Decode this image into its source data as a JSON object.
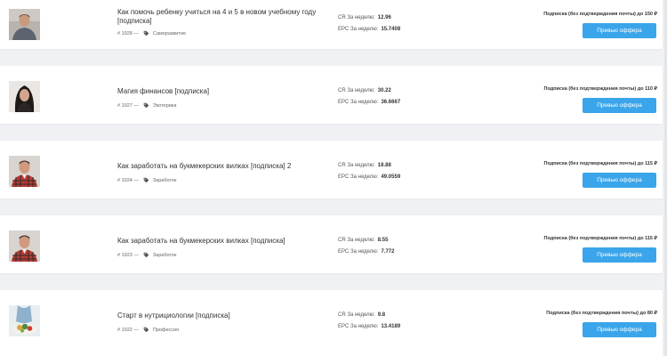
{
  "offers": [
    {
      "title": "Как помочь ребенку учиться на 4 и 5 в новом учебному году [подписка]",
      "id": "# 1928 —",
      "category": "Саморазвитие",
      "cr_label": "CR За неделю:",
      "cr_value": "12.96",
      "epc_label": "EPC За неделю:",
      "epc_value": "15.7408",
      "payout": "Подписка (без подтверждения почты) до 150 ₽",
      "button": "Превью оффера",
      "thumb_icon": "man-portrait-photo"
    },
    {
      "title": "Магия финансов [подписка]",
      "id": "# 1927 —",
      "category": "Эзотерика",
      "cr_label": "CR За неделю:",
      "cr_value": "30.22",
      "epc_label": "EPC За неделю:",
      "epc_value": "36.6667",
      "payout": "Подписка (без подтверждения почты) до 110 ₽",
      "button": "Превью оффера",
      "thumb_icon": "woman-portrait-photo"
    },
    {
      "title": "Как заработать на букмекерских вилках [подписка] 2",
      "id": "# 1924 —",
      "category": "Заработок",
      "cr_label": "CR За неделю:",
      "cr_value": "18.88",
      "epc_label": "EPC За неделю:",
      "epc_value": "49.0559",
      "payout": "Подписка (без подтверждения почты) до 115 ₽",
      "button": "Превью оффера",
      "thumb_icon": "man-plaid-shirt-photo"
    },
    {
      "title": "Как заработать на букмекерских вилках [подписка]",
      "id": "# 1923 —",
      "category": "Заработок",
      "cr_label": "CR За неделю:",
      "cr_value": "8.55",
      "epc_label": "EPC За неделю:",
      "epc_value": "7.772",
      "payout": "Подписка (без подтверждения почты) до 115 ₽",
      "button": "Превью оффера",
      "thumb_icon": "man-plaid-shirt-photo"
    },
    {
      "title": "Старт в нутрициологии [подписка]",
      "id": "# 1922 —",
      "category": "Профессия",
      "cr_label": "CR За неделю:",
      "cr_value": "9.8",
      "epc_label": "EPC За неделю:",
      "epc_value": "13.4189",
      "payout": "Подписка (без подтверждения почты) до 80 ₽",
      "button": "Превью оффера",
      "thumb_icon": "healthy-food-photo"
    }
  ],
  "colors": {
    "accent": "#3aa5ea",
    "background": "#f0f1f4",
    "card": "#ffffff"
  }
}
